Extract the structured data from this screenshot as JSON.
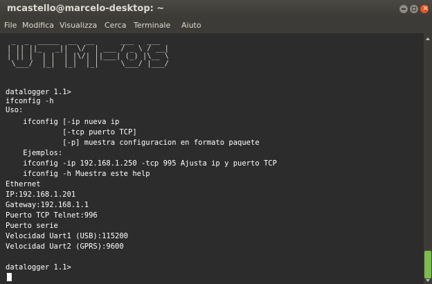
{
  "window": {
    "title": "mcastello@marcelo-desktop: ~",
    "close_color": "#e95420"
  },
  "menu": [
    "File",
    "Modifica",
    "Visualizza",
    "Cerca",
    "Terminale",
    "Aiuto"
  ],
  "terminal": {
    "logo_ascii": " _  _  _____  __  __      ___   ___ \n| || ||_   _||  \\/  | ___ / _ \\ / __|\n| || |  | |  | |\\/| ||___| (_) |\\__ \\\n \\___/  |_|  |_|  |_|     \\___/ |___/",
    "lines": [
      "datalogger 1.1>",
      "ifconfig -h",
      "Uso:",
      "    ifconfig [-ip nueva ip",
      "             [-tcp puerto TCP]",
      "             [-p] muestra configuracion en formato paquete",
      "    Ejemplos:",
      "    ifconfig -ip 192.168.1.250 -tcp 995 Ajusta ip y puerto TCP",
      "    ifconfig -h Muestra este help",
      "Ethernet",
      "IP:192.168.1.201",
      "Gateway:192.168.1.1",
      "Puerto TCP Telnet:996",
      "Puerto serie",
      "Velocidad Uart1 (USB):115200",
      "Velocidad Uart2 (GPRS):9600",
      "",
      "datalogger 1.1>"
    ]
  },
  "scrollbar": {
    "thumb_color": "#7dbb4b"
  }
}
